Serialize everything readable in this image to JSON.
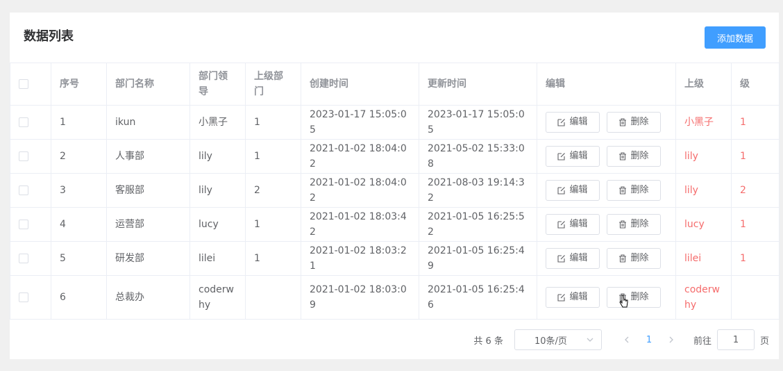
{
  "card": {
    "title": "数据列表",
    "add_button": "添加数据"
  },
  "table": {
    "headers": [
      "",
      "序号",
      "部门名称",
      "部门领导",
      "上级部门",
      "创建时间",
      "更新时间",
      "编辑",
      "上级",
      "级"
    ],
    "edit_label": "编辑",
    "delete_label": "删除",
    "rows": [
      {
        "index": "1",
        "name": "ikun",
        "leader": "小黑子",
        "parent": "1",
        "created": "2023-01-17 15:05:05",
        "updated": "2023-01-17 15:05:05",
        "sup": "小黑子",
        "level": "1"
      },
      {
        "index": "2",
        "name": "人事部",
        "leader": "lily",
        "parent": "1",
        "created": "2021-01-02 18:04:02",
        "updated": "2021-05-02 15:33:08",
        "sup": "lily",
        "level": "1"
      },
      {
        "index": "3",
        "name": "客服部",
        "leader": "lily",
        "parent": "2",
        "created": "2021-01-02 18:04:02",
        "updated": "2021-08-03 19:14:32",
        "sup": "lily",
        "level": "2"
      },
      {
        "index": "4",
        "name": "运营部",
        "leader": "lucy",
        "parent": "1",
        "created": "2021-01-02 18:03:42",
        "updated": "2021-01-05 16:25:52",
        "sup": "lucy",
        "level": "1"
      },
      {
        "index": "5",
        "name": "研发部",
        "leader": "lilei",
        "parent": "1",
        "created": "2021-01-02 18:03:21",
        "updated": "2021-01-05 16:25:49",
        "sup": "lilei",
        "level": "1"
      },
      {
        "index": "6",
        "name": "总裁办",
        "leader": "coderwhy",
        "parent": "",
        "created": "2021-01-02 18:03:09",
        "updated": "2021-01-05 16:25:46",
        "sup": "coderwhy",
        "level": ""
      }
    ]
  },
  "pagination": {
    "total": "共 6 条",
    "page_size": "10条/页",
    "prev_icon": "chevron-left-icon",
    "next_icon": "chevron-right-icon",
    "current_page": "1",
    "goto_label": "前往",
    "goto_value": "1",
    "page_suffix": "页"
  },
  "colors": {
    "primary": "#409eff",
    "danger": "#f56c6c",
    "border": "#ebeef5"
  }
}
